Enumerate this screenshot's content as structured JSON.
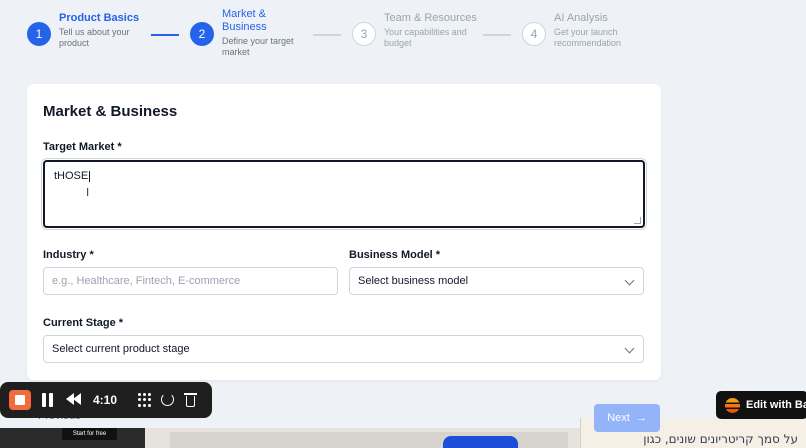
{
  "steps": [
    {
      "number": "1",
      "title": "Product Basics",
      "desc": "Tell us about your product"
    },
    {
      "number": "2",
      "title": "Market & Business",
      "desc": "Define your target market"
    },
    {
      "number": "3",
      "title": "Team & Resources",
      "desc": "Your capabilities and budget"
    },
    {
      "number": "4",
      "title": "AI Analysis",
      "desc": "Get your launch recommendation"
    }
  ],
  "form": {
    "title": "Market & Business",
    "target_market": {
      "label": "Target Market *",
      "value": "tHOSE"
    },
    "industry": {
      "label": "Industry *",
      "placeholder": "e.g., Healthcare, Fintech, E-commerce"
    },
    "business_model": {
      "label": "Business Model *",
      "selected": "Select business model"
    },
    "current_stage": {
      "label": "Current Stage *",
      "selected": "Select current product stage"
    }
  },
  "nav": {
    "previous": "Previous",
    "next": "Next"
  },
  "recorder": {
    "time": "4:10"
  },
  "badge": {
    "label": "Edit with Bas"
  },
  "background": {
    "start_free": "Start for free",
    "rtl_text": "על סמך קריטריונים שונים, כגון"
  },
  "colors": {
    "accent": "#2563eb",
    "next_disabled": "#93b4f8",
    "recorder_stop": "#f26b3a"
  }
}
